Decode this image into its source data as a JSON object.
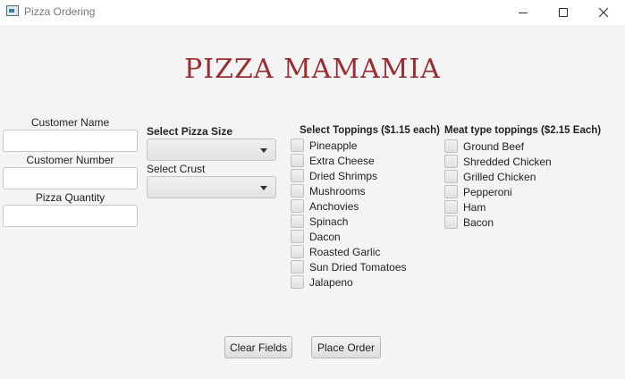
{
  "window": {
    "title": "Pizza Ordering"
  },
  "header": {
    "title": "PIZZA MAMAMIA"
  },
  "customer": {
    "name_label": "Customer Name",
    "name_value": "",
    "number_label": "Customer Number",
    "number_value": "",
    "quantity_label": "Pizza Quantity",
    "quantity_value": ""
  },
  "pizza": {
    "size_label": "Select Pizza Size",
    "size_value": "",
    "crust_label": "Select Crust",
    "crust_value": ""
  },
  "toppings": {
    "heading": "Select Toppings ($1.15 each)",
    "items": [
      "Pineapple",
      "Extra Cheese",
      "Dried Shrimps",
      "Mushrooms",
      "Anchovies",
      "Spinach",
      "Dacon",
      "Roasted Garlic",
      "Sun Dried Tomatoes",
      "Jalapeno"
    ]
  },
  "meat": {
    "heading": "Meat type toppings ($2.15 Each)",
    "items": [
      "Ground Beef",
      "Shredded Chicken",
      "Grilled Chicken",
      "Pepperoni",
      "Ham",
      "Bacon"
    ]
  },
  "actions": {
    "clear_label": "Clear Fields",
    "order_label": "Place Order"
  },
  "colors": {
    "headline": "#9b2d30",
    "background": "#f4f4f4"
  }
}
